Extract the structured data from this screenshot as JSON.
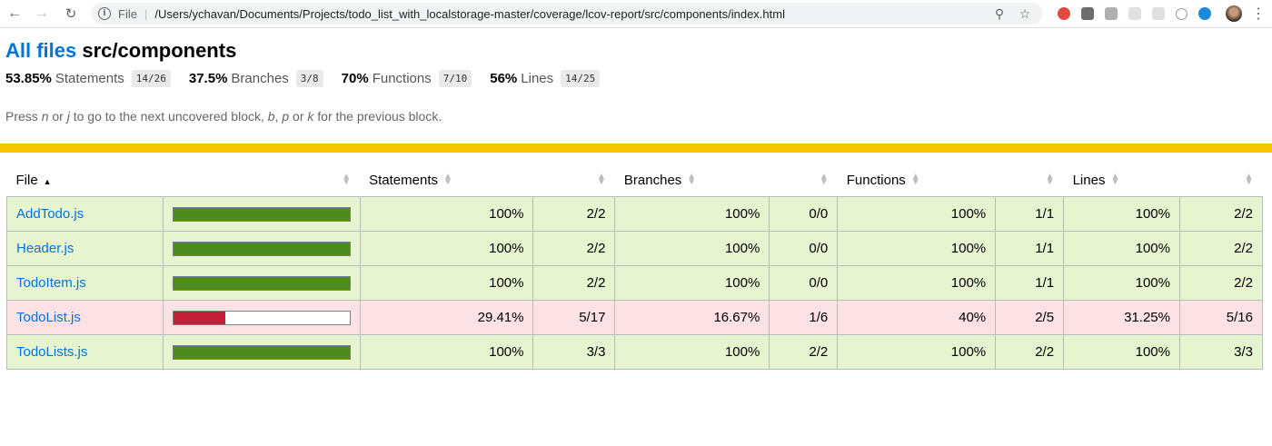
{
  "browser": {
    "file_label": "File",
    "url": "/Users/ychavan/Documents/Projects/todo_list_with_localstorage-master/coverage/lcov-report/src/components/index.html"
  },
  "header": {
    "all_files": "All files",
    "path": "src/components"
  },
  "summary": [
    {
      "pct": "53.85%",
      "label": "Statements",
      "fraction": "14/26"
    },
    {
      "pct": "37.5%",
      "label": "Branches",
      "fraction": "3/8"
    },
    {
      "pct": "70%",
      "label": "Functions",
      "fraction": "7/10"
    },
    {
      "pct": "56%",
      "label": "Lines",
      "fraction": "14/25"
    }
  ],
  "help": {
    "press": "Press ",
    "n": "n",
    "or1": " or ",
    "j": "j",
    "mid": " to go to the next uncovered block, ",
    "b": "b",
    "comma": ", ",
    "p": "p",
    "or2": " or ",
    "k": "k",
    "end": " for the previous block."
  },
  "table": {
    "headers": {
      "file": "File",
      "statements": "Statements",
      "branches": "Branches",
      "functions": "Functions",
      "lines": "Lines"
    },
    "rows": [
      {
        "file": "AddTodo.js",
        "level": "high",
        "coverage": 1.0,
        "statements": "100%",
        "statements_frac": "2/2",
        "branches": "100%",
        "branches_frac": "0/0",
        "functions": "100%",
        "functions_frac": "1/1",
        "lines": "100%",
        "lines_frac": "2/2"
      },
      {
        "file": "Header.js",
        "level": "high",
        "coverage": 1.0,
        "statements": "100%",
        "statements_frac": "2/2",
        "branches": "100%",
        "branches_frac": "0/0",
        "functions": "100%",
        "functions_frac": "1/1",
        "lines": "100%",
        "lines_frac": "2/2"
      },
      {
        "file": "TodoItem.js",
        "level": "high",
        "coverage": 1.0,
        "statements": "100%",
        "statements_frac": "2/2",
        "branches": "100%",
        "branches_frac": "0/0",
        "functions": "100%",
        "functions_frac": "1/1",
        "lines": "100%",
        "lines_frac": "2/2"
      },
      {
        "file": "TodoList.js",
        "level": "low",
        "coverage": 0.2941,
        "statements": "29.41%",
        "statements_frac": "5/17",
        "branches": "16.67%",
        "branches_frac": "1/6",
        "functions": "40%",
        "functions_frac": "2/5",
        "lines": "31.25%",
        "lines_frac": "5/16"
      },
      {
        "file": "TodoLists.js",
        "level": "high",
        "coverage": 1.0,
        "statements": "100%",
        "statements_frac": "3/3",
        "branches": "100%",
        "branches_frac": "2/2",
        "functions": "100%",
        "functions_frac": "2/2",
        "lines": "100%",
        "lines_frac": "3/3"
      }
    ]
  },
  "colors": {
    "status_bar": "#f5c600",
    "high_bg": "#e6f5d0",
    "low_bg": "#fce1e5",
    "fill_green": "#4d8b1e",
    "fill_red": "#c21f39",
    "link": "#0074d9"
  }
}
